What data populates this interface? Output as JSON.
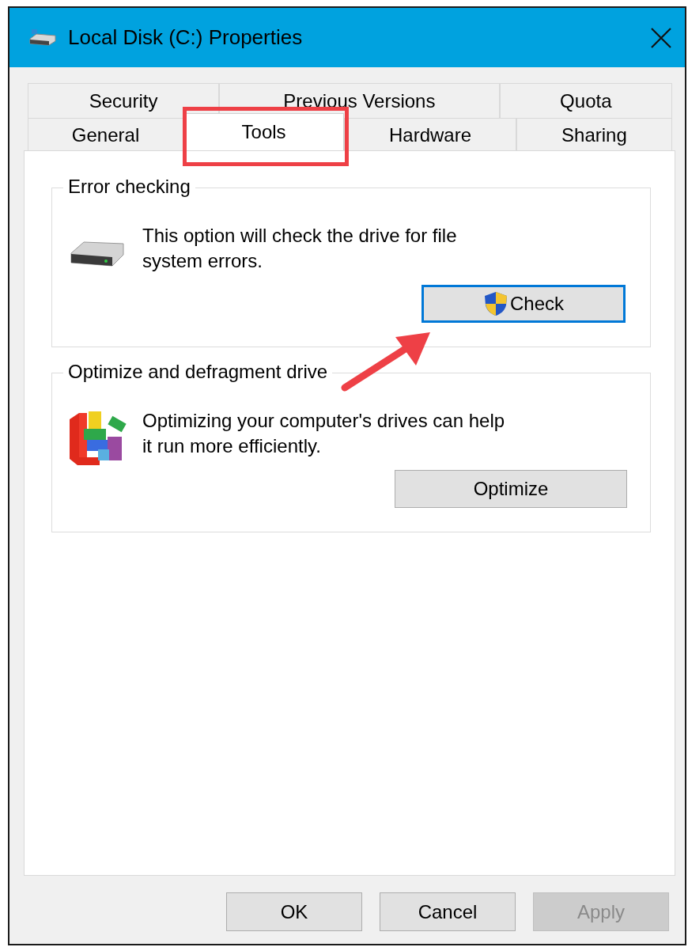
{
  "window": {
    "title": "Local Disk (C:) Properties"
  },
  "tab_rows": [
    {
      "tabs": [
        {
          "label": "Security",
          "selected": false
        },
        {
          "label": "Previous Versions",
          "selected": false
        },
        {
          "label": "Quota",
          "selected": false
        }
      ]
    },
    {
      "tabs": [
        {
          "label": "General",
          "selected": false
        },
        {
          "label": "Tools",
          "selected": true
        },
        {
          "label": "Hardware",
          "selected": false
        },
        {
          "label": "Sharing",
          "selected": false
        }
      ]
    }
  ],
  "groups": [
    {
      "title": "Error checking",
      "kind": "drive",
      "description": "This option will check the drive for file system errors.",
      "button": {
        "label": "Check",
        "elevated": true,
        "focused": true
      }
    },
    {
      "title": "Optimize and defragment drive",
      "kind": "defrag",
      "description": "Optimizing your computer's drives can help it run more efficiently.",
      "button": {
        "label": "Optimize",
        "elevated": false,
        "focused": false
      }
    }
  ],
  "buttons": [
    {
      "label": "OK",
      "disabled": false
    },
    {
      "label": "Cancel",
      "disabled": false
    },
    {
      "label": "Apply",
      "disabled": true
    }
  ]
}
